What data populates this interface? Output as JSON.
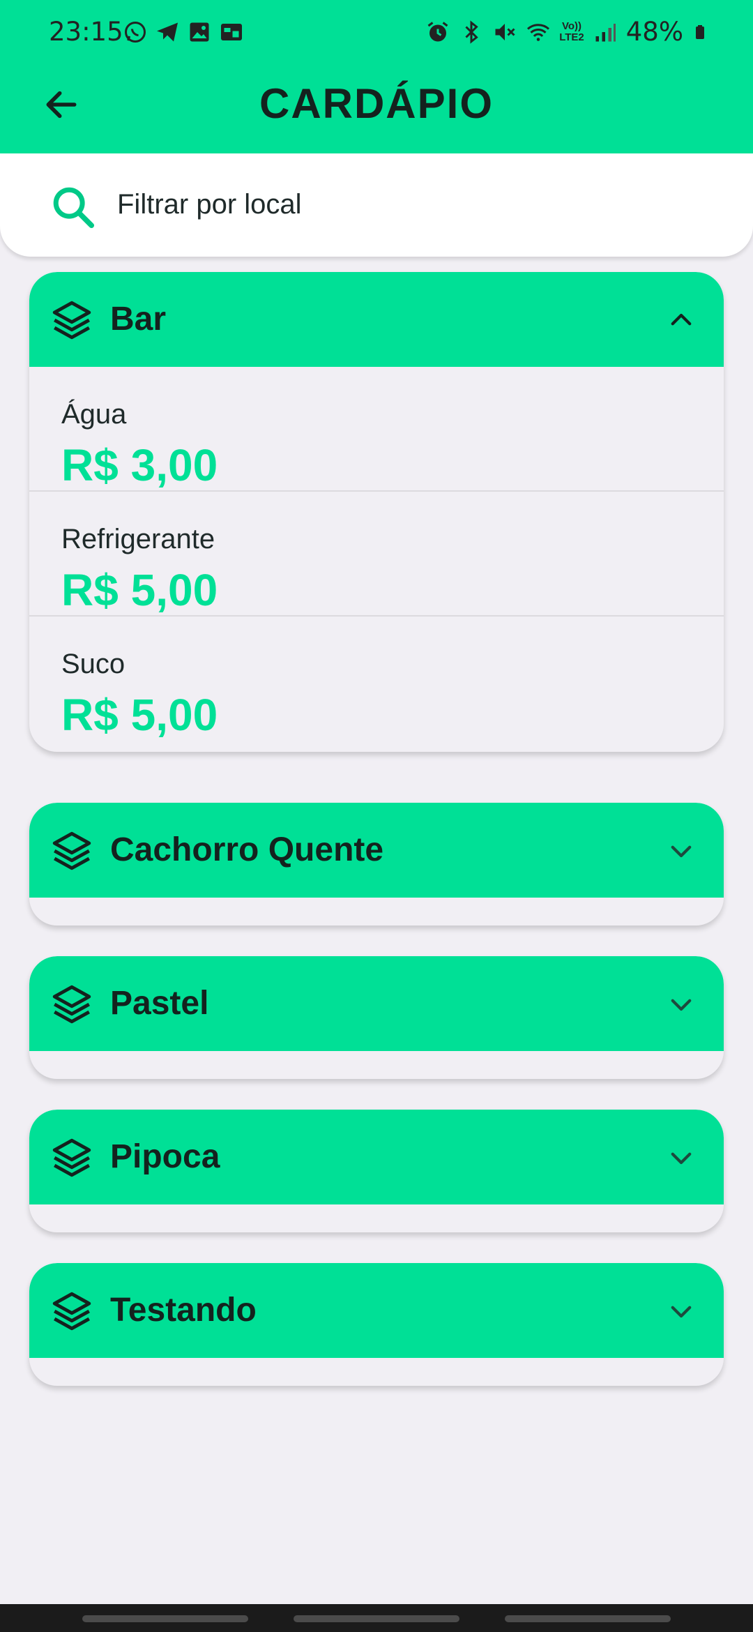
{
  "status_bar": {
    "time": "23:15",
    "battery": "48%",
    "volte_line1": "Vo))",
    "volte_line2": "LTE2"
  },
  "header": {
    "title": "CARDÁPIO",
    "accent_color": "#00e096"
  },
  "search": {
    "placeholder": "Filtrar por local"
  },
  "categories": [
    {
      "name": "Bar",
      "expanded": true,
      "items": [
        {
          "name": "Água",
          "price": "R$ 3,00"
        },
        {
          "name": "Refrigerante",
          "price": "R$ 5,00"
        },
        {
          "name": "Suco",
          "price": "R$ 5,00"
        }
      ]
    },
    {
      "name": "Cachorro Quente",
      "expanded": false
    },
    {
      "name": "Pastel",
      "expanded": false
    },
    {
      "name": "Pipoca",
      "expanded": false
    },
    {
      "name": "Testando",
      "expanded": false
    }
  ]
}
